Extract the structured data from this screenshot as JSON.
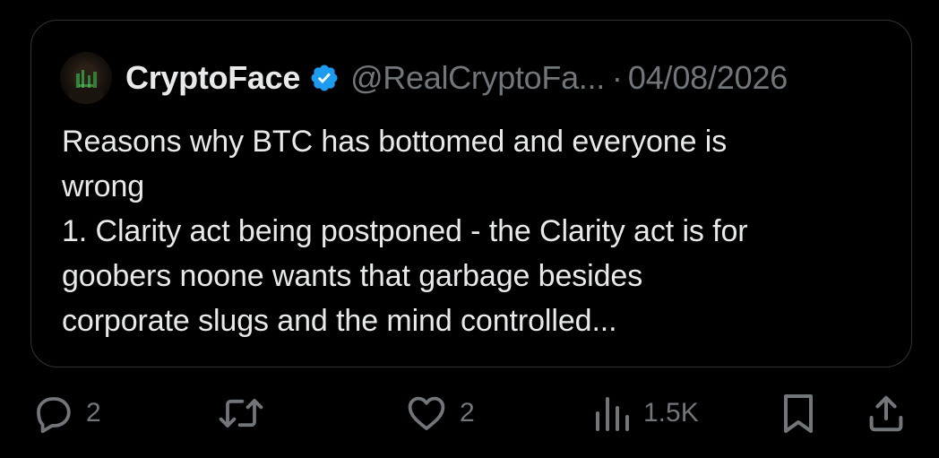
{
  "quote": {
    "author": {
      "display_name": "CryptoFace",
      "handle": "@RealCryptoFa...",
      "separator": "·",
      "date": "04/08/2026",
      "avatar_icon": "avatar-image",
      "verified_icon": "verified-badge-icon"
    },
    "text": "Reasons why BTC has bottomed and everyone is\nwrong\n1. Clarity act being postponed - the Clarity act is for\ngoobers noone wants that garbage besides\ncorporate slugs and the mind controlled..."
  },
  "actions": {
    "reply": {
      "icon": "reply-icon",
      "count": "2"
    },
    "retweet": {
      "icon": "retweet-icon"
    },
    "like": {
      "icon": "heart-icon",
      "count": "2"
    },
    "views": {
      "icon": "views-icon",
      "count": "1.5K"
    },
    "bookmark": {
      "icon": "bookmark-icon"
    },
    "share": {
      "icon": "share-icon"
    }
  },
  "colors": {
    "background": "#000000",
    "text_primary": "#e7e9ea",
    "text_secondary": "#71767b",
    "border": "#2f3336",
    "verified_blue": "#1d9bf0"
  }
}
